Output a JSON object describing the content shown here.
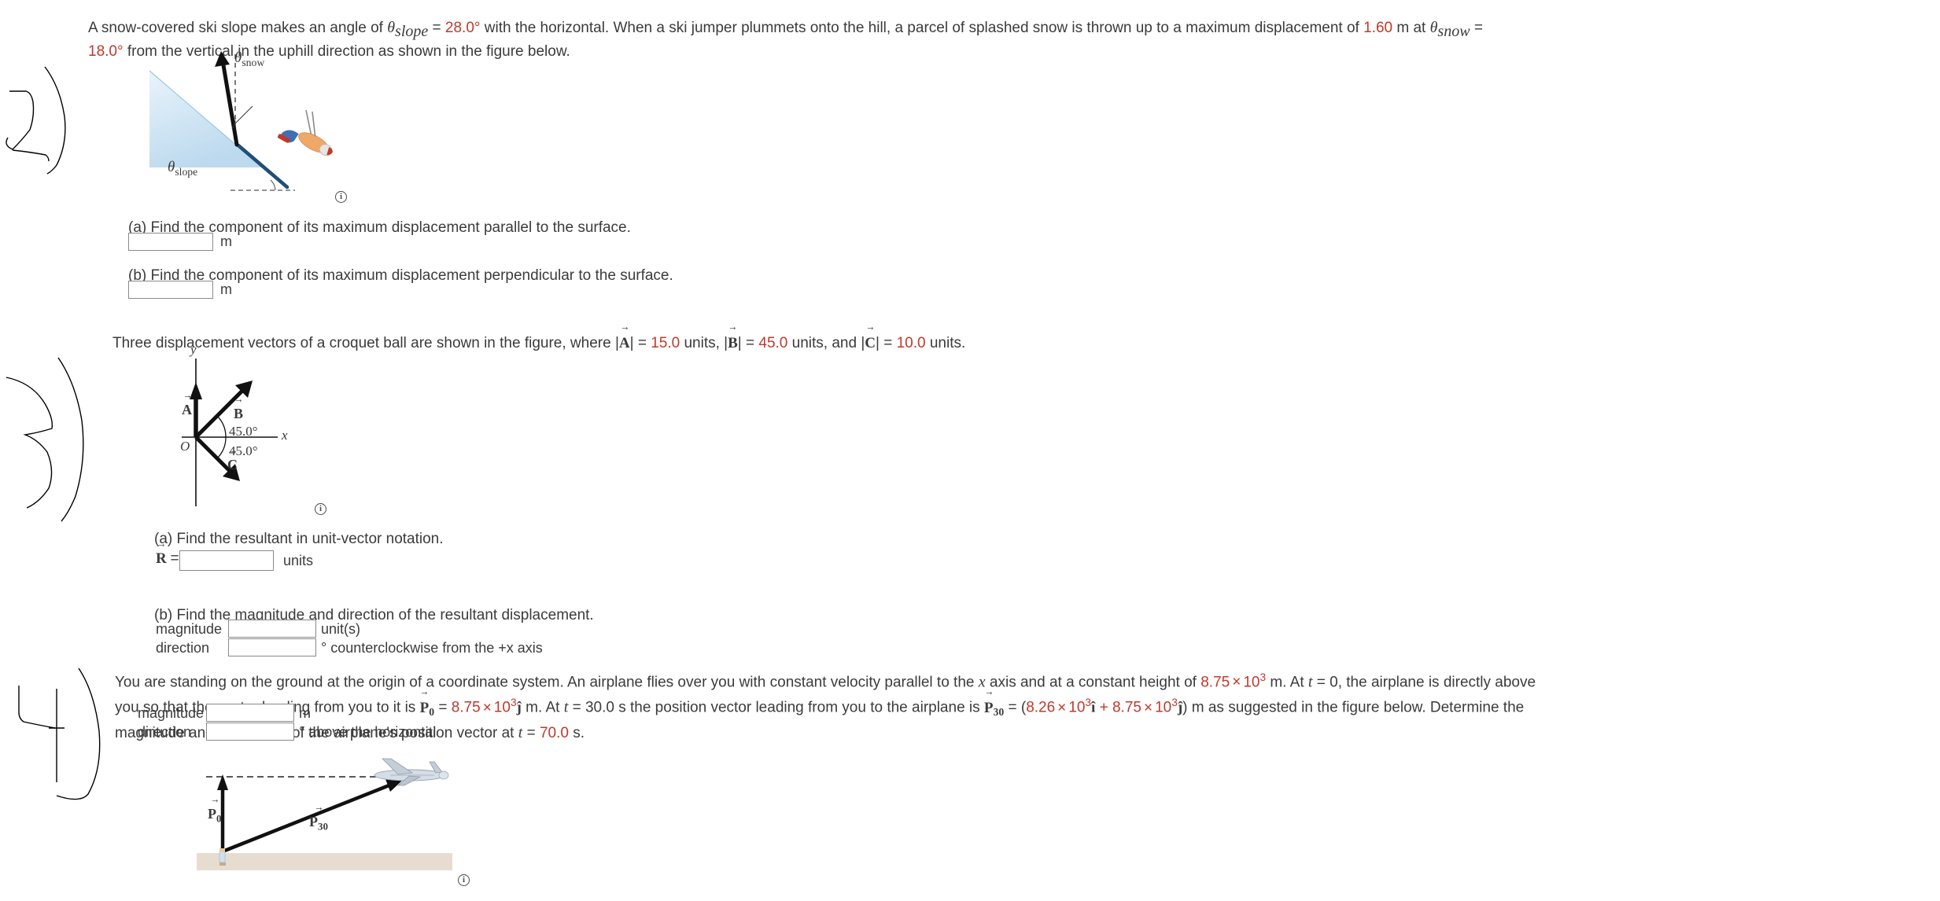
{
  "problem1": {
    "text_parts": {
      "p1": "A snow-covered ski slope makes an angle of ",
      "theta_slope_sym": "θ",
      "theta_slope_sub": "slope",
      "eq1": " = ",
      "angle_slope": "28.0°",
      "p2": " with the horizontal. When a ski jumper plummets onto the hill, a parcel of splashed snow is thrown up to a maximum displacement of ",
      "displacement": "1.60",
      "p3": " m at ",
      "theta_snow_sym": "θ",
      "theta_snow_sub": "snow",
      "eq2": " = ",
      "angle_snow": "18.0°",
      "p4": " from the vertical in the uphill direction as shown in the figure below."
    },
    "figure": {
      "label_snow_sym": "θ",
      "label_snow_sub": "snow",
      "label_slope_sym": "θ",
      "label_slope_sub": "slope",
      "info_label": "i"
    },
    "parts": [
      {
        "prompt": "(a) Find the component of its maximum displacement parallel to the surface.",
        "value": "",
        "unit": "m"
      },
      {
        "prompt": "(b) Find the component of its maximum displacement perpendicular to the surface.",
        "value": "",
        "unit": "m"
      }
    ]
  },
  "problem2": {
    "text_parts": {
      "p1": "Three displacement vectors of a croquet ball are shown in the figure, where |",
      "vecA": "A",
      "p2": "| = ",
      "magA": "15.0",
      "p3": " units, |",
      "vecB": "B",
      "p4": "| = ",
      "magB": "45.0",
      "p5": " units, and |",
      "vecC": "C",
      "p6": "| = ",
      "magC": "10.0",
      "p7": " units."
    },
    "figure": {
      "axis_y": "y",
      "axis_x": "x",
      "origin": "O",
      "vecA": "A",
      "vecB": "B",
      "vecC": "C",
      "angle_upper": "45.0°",
      "angle_lower": "45.0°",
      "info_label": "i"
    },
    "parts": {
      "a_prompt": "(a) Find the resultant in unit-vector notation.",
      "a_symbol": "R",
      "a_equals": "=",
      "a_value": "",
      "a_unit": "units",
      "b_prompt": "(b) Find the magnitude and direction of the resultant displacement.",
      "b_rows": [
        {
          "label": "magnitude",
          "value": "",
          "unit": "unit(s)"
        },
        {
          "label": "direction",
          "value": "",
          "unit": "° counterclockwise from the +x axis"
        }
      ]
    }
  },
  "problem3": {
    "text_parts": {
      "p1": "You are standing on the ground at the origin of a coordinate system. An airplane flies over you with constant velocity parallel to the ",
      "x1": "x",
      "p2": " axis and at a constant height of ",
      "height_mant": "8.75",
      "times": "×",
      "height_base": "10",
      "height_exp": "3",
      "p3": " m. At ",
      "t1": "t",
      "p4": " = 0, the airplane is directly above you so that the vector leading from you to it is ",
      "vecP0": "P",
      "vecP0_sub": "0",
      "p5": " = ",
      "p0_mant": "8.75",
      "p0_base": "10",
      "p0_exp": "3",
      "jhat": "ĵ",
      "p6": " m. At ",
      "t2": "t",
      "p7": " = 30.0 s the position vector leading from you to the airplane is ",
      "vecP30": "P",
      "vecP30_sub": "30",
      "p8": " = (",
      "p30x_mant": "8.26",
      "p30x_base": "10",
      "p30x_exp": "3",
      "ihat": "î",
      "plus": " + ",
      "p30y_mant": "8.75",
      "p30y_base": "10",
      "p30y_exp": "3",
      "p9": ") m as suggested in the figure below. Determine the magnitude and orientation of the airplane's position vector at ",
      "t3": "t",
      "p10": " = ",
      "time_final": "70.0",
      "p11": " s."
    },
    "rows": [
      {
        "label": "magnitude",
        "value": "",
        "unit": "m"
      },
      {
        "label": "direction",
        "value": "",
        "unit": "° above the horizontal"
      }
    ],
    "figure": {
      "vecP0": "P",
      "vecP0_sub": "0",
      "vecP30": "P",
      "vecP30_sub": "30",
      "info_label": "i"
    }
  },
  "colors": {
    "value_red": "#c0392b",
    "text": "#3b3b3b",
    "box_border": "#8a8a8a",
    "snow_fill": "#cfe4f2",
    "slope_line": "#1f4e79",
    "ground": "#e6ddd0"
  }
}
